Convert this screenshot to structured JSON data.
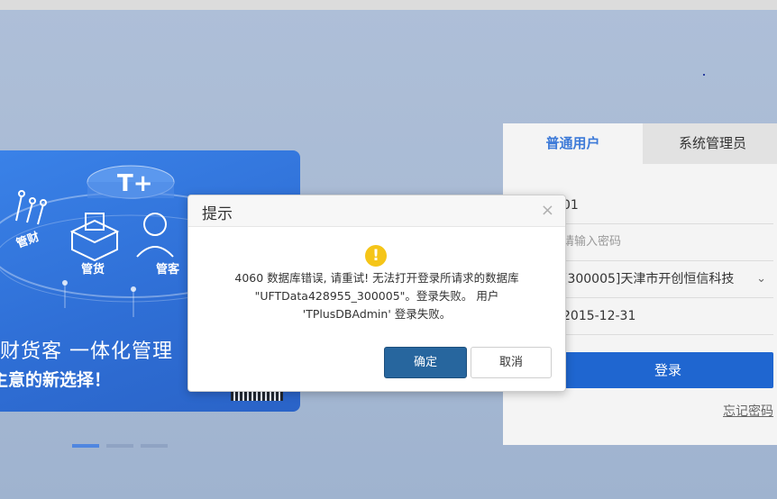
{
  "topbar": {
    "text": ""
  },
  "banner": {
    "icon_labels": {
      "finance": "管财",
      "goods": "管货",
      "customers": "管客",
      "product": "T+"
    },
    "headline": "财货客 一体化管理",
    "subline": "主意的新选择！"
  },
  "carousel": {
    "dots": 3,
    "active": 0
  },
  "login": {
    "tabs": [
      "普通用户",
      "系统管理员"
    ],
    "active_tab": 0,
    "username_value": "01",
    "password_placeholder": "请输入密码",
    "account_value": "[300005]天津市开创恒信科技",
    "date_value": "2015-12-31",
    "login_label": "登录",
    "forgot_label": "忘记密码"
  },
  "dialog": {
    "title": "提示",
    "close_glyph": "×",
    "icon": "warning-icon",
    "message_line1": "4060 数据库错误, 请重试! 无法打开登录所请求的数据库",
    "message_line2": "\"UFTData428955_300005\"。登录失败。 用户",
    "message_line3": "'TPlusDBAdmin' 登录失败。",
    "ok_label": "确定",
    "cancel_label": "取消"
  },
  "colors": {
    "accent": "#1f66d0",
    "dialog_ok": "#27669e",
    "warning": "#f5c518"
  }
}
